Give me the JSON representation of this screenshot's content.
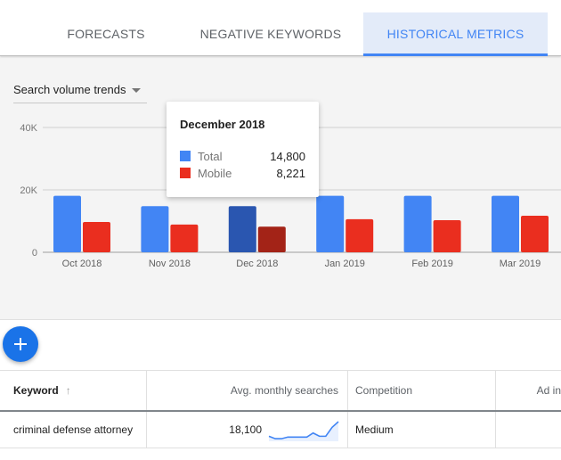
{
  "tabs": [
    {
      "label": "FORECASTS",
      "active": false
    },
    {
      "label": "NEGATIVE KEYWORDS",
      "active": false
    },
    {
      "label": "HISTORICAL METRICS",
      "active": true
    }
  ],
  "dropdown": {
    "selected": "Search volume trends",
    "icon": "caret-down-icon"
  },
  "colors": {
    "total": "#4285f4",
    "mobile": "#ea2e1f",
    "total_highlight": "#2a56b0",
    "mobile_highlight": "#a32317",
    "accent": "#1a73e8"
  },
  "chart_data": {
    "type": "bar",
    "title": "Search volume trends",
    "xlabel": "",
    "ylabel": "",
    "ylim": [
      0,
      40000
    ],
    "yticks": [
      0,
      20000,
      40000
    ],
    "ytick_labels": [
      "0",
      "20K",
      "40K"
    ],
    "grid": true,
    "categories": [
      "Oct 2018",
      "Nov 2018",
      "Dec 2018",
      "Jan 2019",
      "Feb 2019",
      "Mar 2019"
    ],
    "highlighted_category": "Dec 2018",
    "series": [
      {
        "name": "Total",
        "values": [
          18100,
          14800,
          14800,
          18100,
          18100,
          18100
        ]
      },
      {
        "name": "Mobile",
        "values": [
          9700,
          8900,
          8221,
          10600,
          10300,
          11700
        ]
      }
    ]
  },
  "tooltip": {
    "title": "December 2018",
    "rows": [
      {
        "name": "Total",
        "value": "14,800"
      },
      {
        "name": "Mobile",
        "value": "8,221"
      }
    ]
  },
  "fab": {
    "icon": "plus-icon",
    "label": "Add"
  },
  "table": {
    "headers": {
      "keyword": "Keyword",
      "avg_searches": "Avg. monthly searches",
      "competition": "Competition",
      "ad_impression": "Ad in"
    },
    "sort_icon": "arrow-up-icon",
    "rows": [
      {
        "keyword": "criminal defense attorney",
        "avg_searches": "18,100",
        "trend": [
          4,
          1,
          1,
          3,
          3,
          3,
          3,
          8,
          4,
          4,
          15,
          22
        ],
        "competition": "Medium",
        "ad_impression": ""
      }
    ]
  }
}
